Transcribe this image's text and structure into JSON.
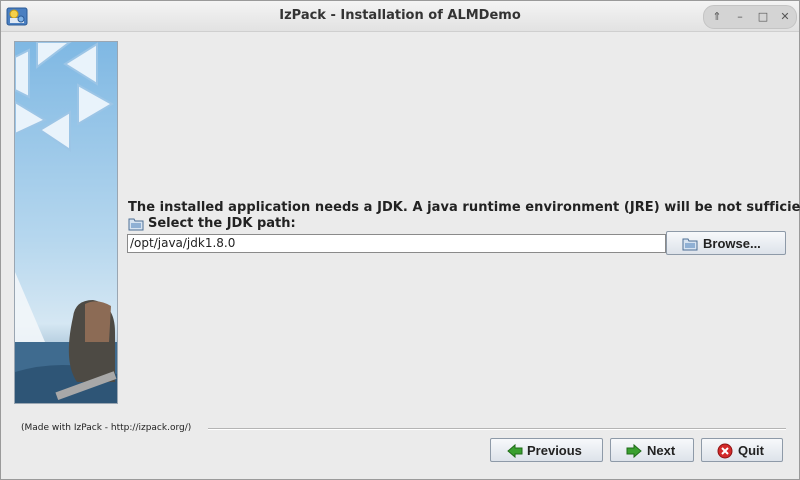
{
  "window": {
    "title": "IzPack - Installation of ALMDemo",
    "controls": [
      "restore-up-icon",
      "minimize-icon",
      "maximize-icon",
      "close-icon"
    ]
  },
  "panel": {
    "message": "The installed application needs a JDK. A java runtime environment (JRE) will be not sufficient.",
    "jdk_label": "Select the JDK path:",
    "jdk_path": "/opt/java/jdk1.8.0",
    "browse_label": "Browse..."
  },
  "footer": {
    "made_with": "(Made with IzPack - http://izpack.org/)",
    "previous_label": "Previous",
    "next_label": "Next",
    "quit_label": "Quit"
  },
  "colors": {
    "button_border": "#8e9aa8",
    "sky": "#8ec3e8",
    "arrow_green": "#3aa02f",
    "quit_red": "#d32a2a"
  }
}
